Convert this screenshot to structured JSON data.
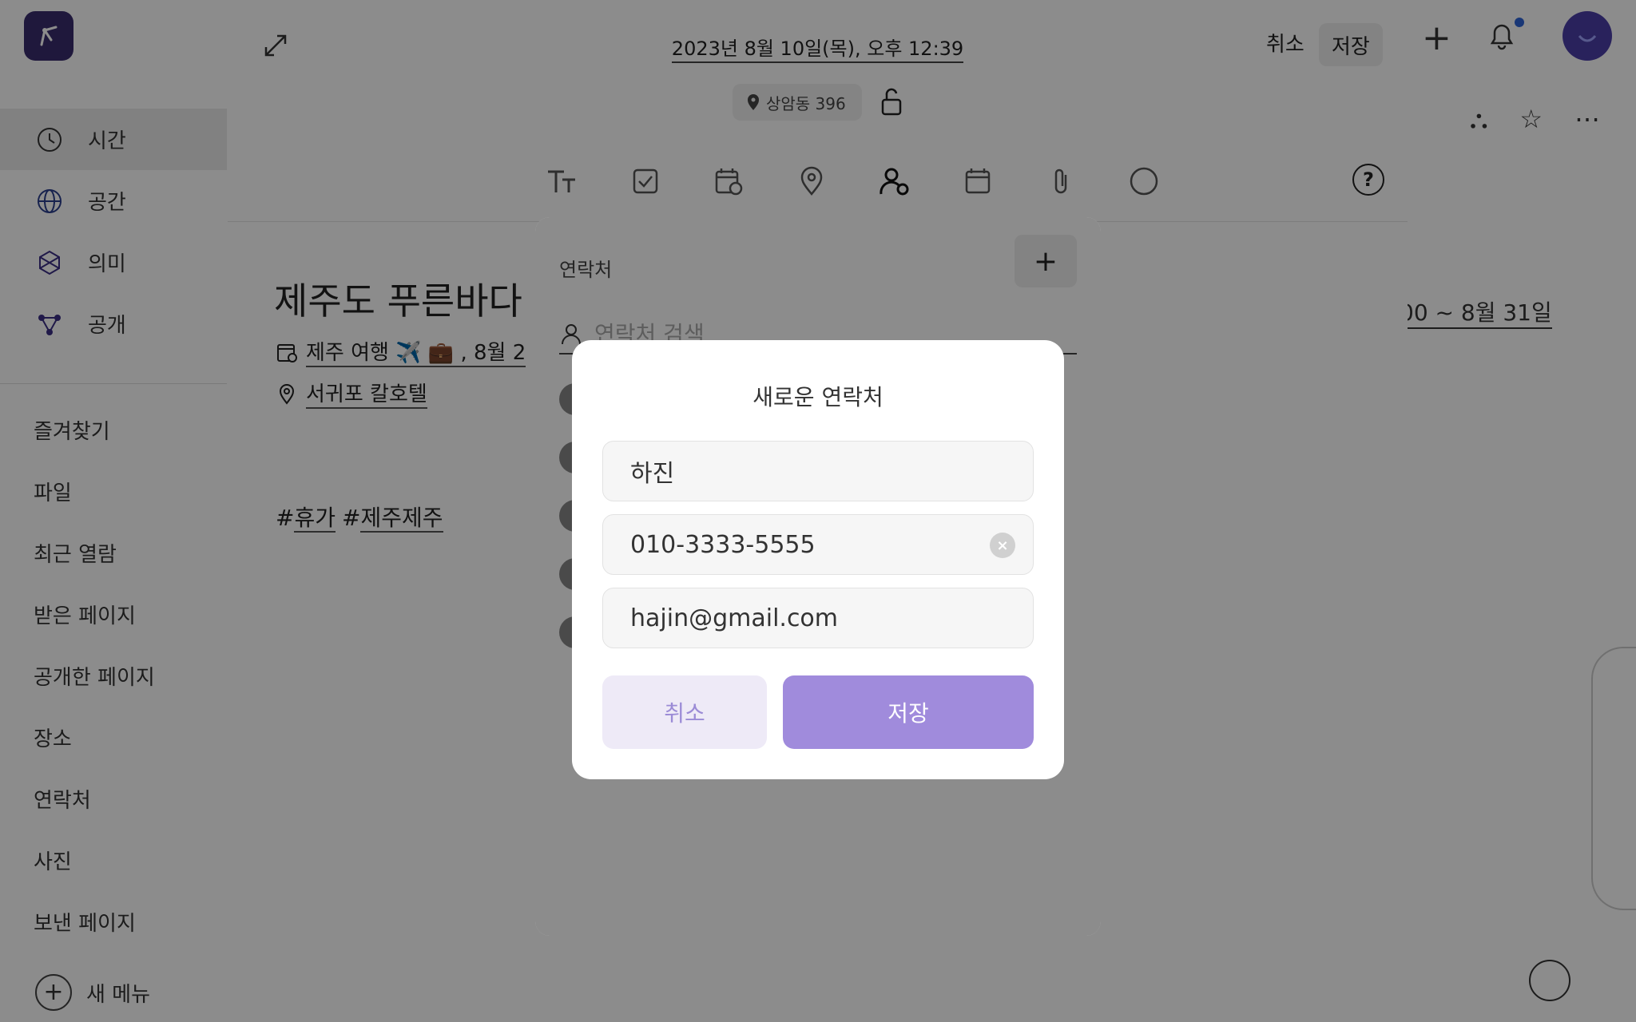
{
  "sidebar": {
    "main_items": [
      {
        "label": "시간",
        "icon": "history-icon"
      },
      {
        "label": "공간",
        "icon": "globe-icon"
      },
      {
        "label": "의미",
        "icon": "meaning-icon"
      },
      {
        "label": "공개",
        "icon": "share-icon"
      }
    ],
    "list_items": [
      "즐겨찾기",
      "파일",
      "최근 열람",
      "받은 페이지",
      "공개한 페이지",
      "장소",
      "연락처",
      "사진",
      "보낸 페이지"
    ],
    "new_menu_label": "새 메뉴"
  },
  "background": {
    "date_range": "00 ~ 8월 31일"
  },
  "editor": {
    "datetime": "2023년 8월 10일(목), 오후 12:39",
    "cancel_label": "취소",
    "save_label": "저장",
    "location_chip": "상암동 396",
    "help_label": "?",
    "title": "제주도 푸른바다",
    "event": "제주 여행 ✈️ 💼 , 8월 2",
    "place": "서귀포 칼호텔",
    "tags": [
      "휴가",
      "제주제주"
    ]
  },
  "contacts_panel": {
    "title": "연락처",
    "add_label": "+",
    "search_placeholder": "연락처 검색"
  },
  "modal": {
    "title": "새로운 연락처",
    "name_value": "하진",
    "phone_value": "010-3333-5555",
    "email_value": "hajin@gmail.com",
    "cancel_label": "취소",
    "save_label": "저장"
  },
  "colors": {
    "accent": "#a08bdc",
    "accent_light": "#eeeaf7",
    "brand": "#3a2d6e"
  }
}
